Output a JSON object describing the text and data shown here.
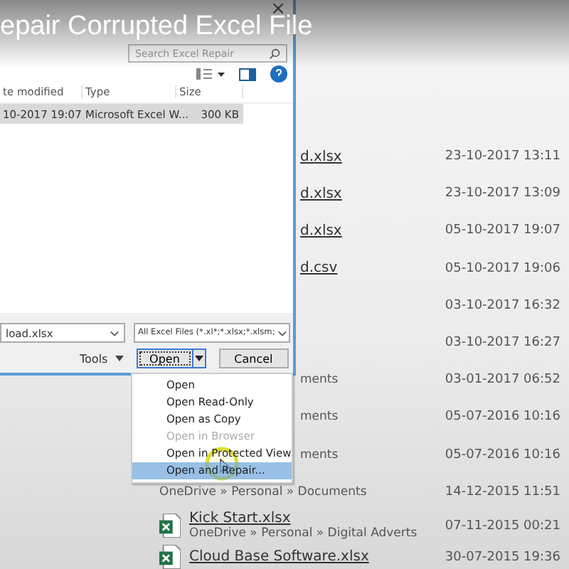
{
  "video_title": "epair Corrupted Excel File",
  "recent_files": [
    {
      "kind": "partial",
      "name": "d.xlsx",
      "date": "23-10-2017 13:11"
    },
    {
      "kind": "partial",
      "name": "d.xlsx",
      "date": "23-10-2017 13:09"
    },
    {
      "kind": "partial",
      "name": "d.xlsx",
      "date": "05-10-2017 19:07"
    },
    {
      "kind": "partial",
      "name": "d.csv",
      "date": "05-10-2017 19:06"
    },
    {
      "kind": "partial",
      "date": "03-10-2017 16:32"
    },
    {
      "kind": "partial",
      "date": "03-10-2017 16:27"
    },
    {
      "kind": "partial",
      "path": "ments",
      "date": "03-01-2017 06:52"
    },
    {
      "kind": "partial",
      "path": "ments",
      "date": "05-07-2016 10:16"
    },
    {
      "kind": "partial",
      "path": "ments",
      "date": "05-07-2016 10:16"
    },
    {
      "kind": "full",
      "path": "OneDrive » Personal » Documents",
      "date": "14-12-2015 11:51"
    },
    {
      "kind": "full",
      "name": "Kick Start.xlsx",
      "path": "OneDrive » Personal » Digital Adverts",
      "date": "07-11-2015 00:21"
    },
    {
      "kind": "full",
      "name": "Cloud Base Software.xlsx",
      "date": "30-07-2015 19:36"
    }
  ],
  "dialog": {
    "close": "×",
    "search": {
      "placeholder": "Search Excel Repair"
    },
    "columns": [
      "te modified",
      "Type",
      "Size"
    ],
    "rows": [
      {
        "cells": [
          "10-2017 19:07",
          "Microsoft Excel W...",
          "300 KB"
        ],
        "selected": true
      }
    ],
    "file_name": "load.xlsx",
    "file_type": "All Excel Files (*.xl*;*.xlsx;*.xlsm;",
    "tools": "Tools",
    "open": "Open",
    "cancel": "Cancel"
  },
  "open_menu": [
    {
      "label": "Open",
      "disabled": false,
      "selected": false
    },
    {
      "label": "Open Read-Only",
      "disabled": false,
      "selected": false
    },
    {
      "label": "Open as Copy",
      "disabled": false,
      "selected": false
    },
    {
      "label": "Open in Browser",
      "disabled": true,
      "selected": false
    },
    {
      "label": "Open in Protected View",
      "disabled": false,
      "selected": false
    },
    {
      "label": "Open and Repair...",
      "disabled": false,
      "selected": true
    }
  ]
}
